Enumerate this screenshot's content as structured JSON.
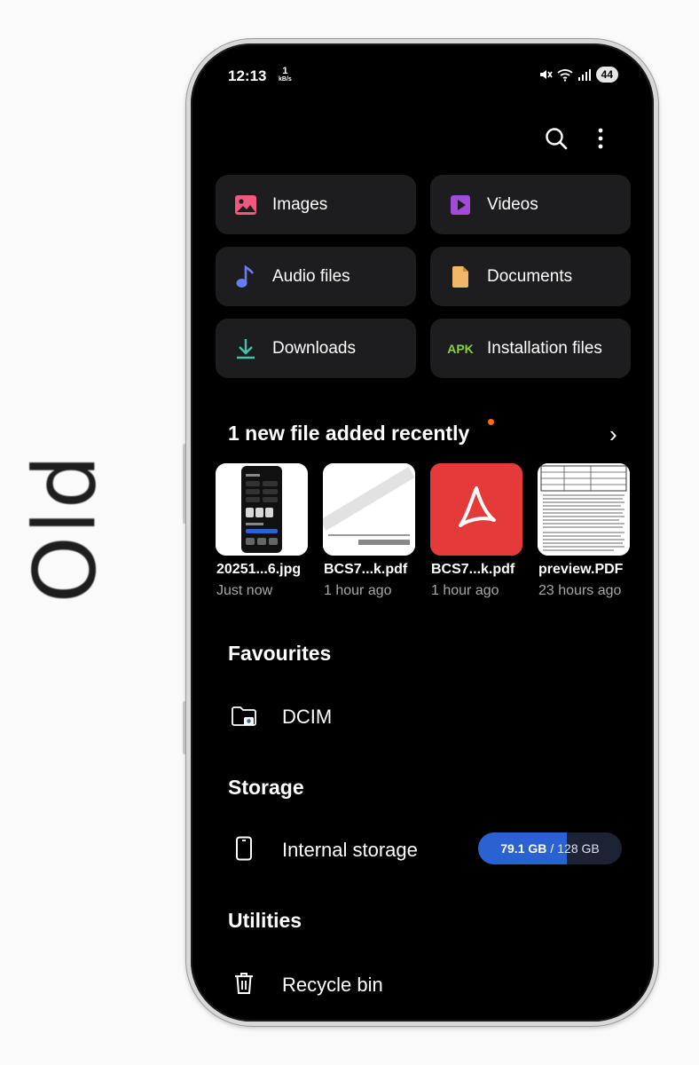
{
  "side_label": "Old",
  "status": {
    "time": "12:13",
    "net_speed_value": "1",
    "net_speed_unit": "kB/s",
    "battery": "44"
  },
  "toolbar": {
    "search_icon": "search-icon",
    "more_icon": "more-vert-icon"
  },
  "categories": [
    {
      "label": "Images",
      "icon": "image-icon",
      "color": "#f0587d"
    },
    {
      "label": "Videos",
      "icon": "video-icon",
      "color": "#a14bd8"
    },
    {
      "label": "Audio files",
      "icon": "music-note-icon",
      "color": "#6a7cf0"
    },
    {
      "label": "Documents",
      "icon": "document-icon",
      "color": "#f2b766"
    },
    {
      "label": "Downloads",
      "icon": "download-icon",
      "color": "#3fc6a8"
    },
    {
      "label": "Installation files",
      "icon": "apk-icon",
      "badge": "APK",
      "color": "#8bd13a"
    }
  ],
  "recent": {
    "title": "1 new file added recently",
    "files": [
      {
        "name": "20251...6.jpg",
        "time": "Just now"
      },
      {
        "name": "BCS7...k.pdf",
        "time": "1 hour ago"
      },
      {
        "name": "BCS7...k.pdf",
        "time": "1 hour ago"
      },
      {
        "name": "preview.PDF",
        "time": "23 hours ago"
      }
    ]
  },
  "favourites": {
    "title": "Favourites",
    "items": [
      {
        "label": "DCIM"
      }
    ]
  },
  "storage": {
    "title": "Storage",
    "internal": {
      "label": "Internal storage",
      "used": "79.1 GB",
      "separator": "/",
      "total": "128 GB",
      "used_fraction": 0.618
    }
  },
  "utilities": {
    "title": "Utilities",
    "items": [
      {
        "label": "Recycle bin"
      }
    ]
  },
  "colors": {
    "accent_blue": "#2a62d4",
    "new_dot": "#ff6a1a",
    "pdf_red": "#e53a3a"
  }
}
